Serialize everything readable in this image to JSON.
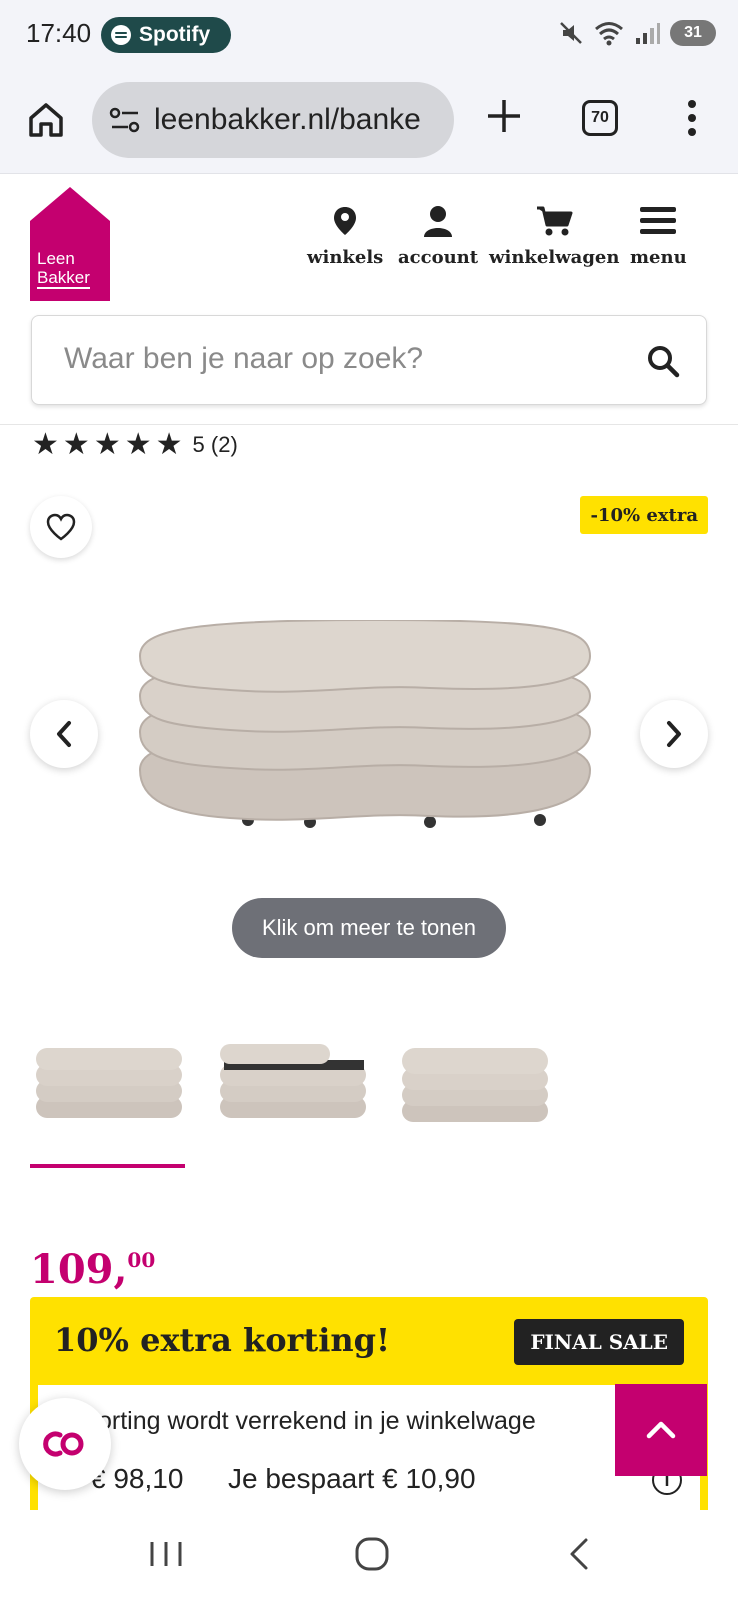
{
  "status_bar": {
    "time": "17:40",
    "now_playing_app": "Spotify",
    "battery": "31"
  },
  "browser": {
    "url": "leenbakker.nl/banke",
    "tab_count": "70"
  },
  "site": {
    "logo_line1": "Leen",
    "logo_line2": "Bakker",
    "brand_color": "#c4006f",
    "nav": [
      {
        "label": "winkels",
        "icon": "map-pin-icon"
      },
      {
        "label": "account",
        "icon": "user-icon"
      },
      {
        "label": "winkelwagen",
        "icon": "cart-icon"
      },
      {
        "label": "menu",
        "icon": "hamburger-icon"
      }
    ],
    "search_placeholder": "Waar ben je naar op zoek?"
  },
  "product": {
    "stars": 5,
    "rating_text": "5 (2)",
    "badge": "-10% extra",
    "more_button": "Klik om meer te tonen",
    "price_main": "109,",
    "price_cents": "00",
    "gallery_selected_index": 0
  },
  "promo": {
    "title": "10% extra korting!",
    "final_sale": "FINAL SALE",
    "note": "orting wordt verrekend in je winkelwage",
    "now_price": "€ 98,10",
    "savings": "Je bespaart € 10,90",
    "accent_color": "#ffe100"
  }
}
